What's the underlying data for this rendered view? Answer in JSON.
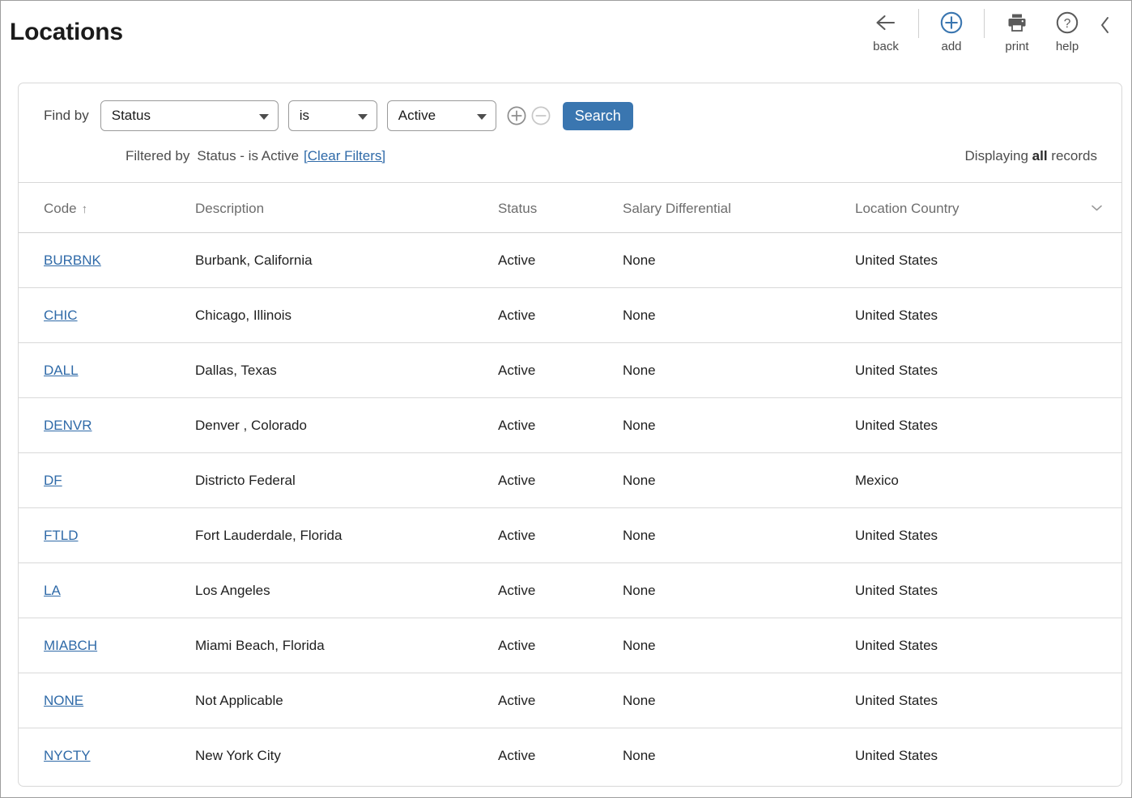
{
  "header": {
    "title": "Locations",
    "toolbar": [
      {
        "icon": "back-arrow-icon",
        "label": "back"
      },
      {
        "icon": "add-circle-plus-icon",
        "label": "add"
      },
      {
        "icon": "print-icon",
        "label": "print"
      },
      {
        "icon": "help-question-icon",
        "label": "help"
      }
    ],
    "collapse_icon": "chevron-left-icon"
  },
  "find": {
    "label": "Find by",
    "field": "Status",
    "operator": "is",
    "value": "Active",
    "add_icon": "plus-circle-icon",
    "remove_icon": "minus-circle-icon",
    "search_label": "Search",
    "filtered_label": "Filtered by",
    "filtered_expression": "Status - is Active",
    "clear_filters": "[Clear Filters]",
    "displaying_prefix": "Displaying ",
    "displaying_emphasis": "all",
    "displaying_suffix": " records"
  },
  "colors": {
    "accent_blue": "#3a76b0",
    "link_blue": "#2f6aa8",
    "header_text": "#6d6d6d",
    "border": "#d8d8d8"
  },
  "table": {
    "sort_column": "Code",
    "sort_direction": "↑",
    "menu_icon": "chevron-down-icon",
    "columns": [
      "Code",
      "Description",
      "Status",
      "Salary Differential",
      "Location Country"
    ],
    "rows": [
      {
        "code": "BURBNK",
        "description": "Burbank, California",
        "status": "Active",
        "salary": "None",
        "country": "United States"
      },
      {
        "code": "CHIC",
        "description": "Chicago, Illinois",
        "status": "Active",
        "salary": "None",
        "country": "United States"
      },
      {
        "code": "DALL",
        "description": "Dallas, Texas",
        "status": "Active",
        "salary": "None",
        "country": "United States"
      },
      {
        "code": "DENVR",
        "description": "Denver , Colorado",
        "status": "Active",
        "salary": "None",
        "country": "United States"
      },
      {
        "code": "DF",
        "description": "Districto Federal",
        "status": "Active",
        "salary": "None",
        "country": "Mexico"
      },
      {
        "code": "FTLD",
        "description": "Fort Lauderdale, Florida",
        "status": "Active",
        "salary": "None",
        "country": "United States"
      },
      {
        "code": "LA",
        "description": "Los Angeles",
        "status": "Active",
        "salary": "None",
        "country": "United States"
      },
      {
        "code": "MIABCH",
        "description": "Miami Beach, Florida",
        "status": "Active",
        "salary": "None",
        "country": "United States"
      },
      {
        "code": "NONE",
        "description": "Not Applicable",
        "status": "Active",
        "salary": "None",
        "country": "United States"
      },
      {
        "code": "NYCTY",
        "description": "New York City",
        "status": "Active",
        "salary": "None",
        "country": "United States"
      }
    ]
  }
}
